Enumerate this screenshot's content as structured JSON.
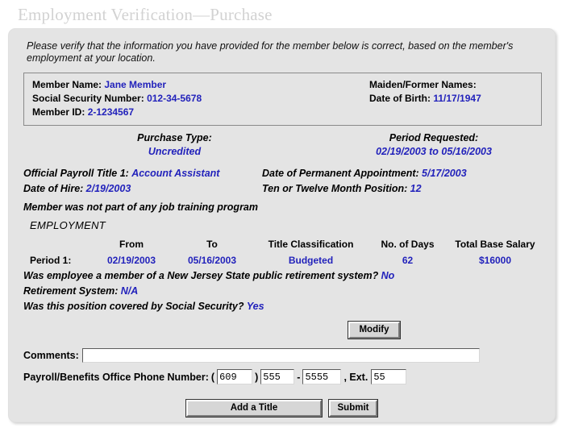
{
  "page": {
    "title": "Employment Verification—Purchase",
    "intro": "Please verify that the information you have provided for the member below is correct, based on the member's employment at your location."
  },
  "member_box": {
    "member_name_label": "Member Name:",
    "member_name_value": "Jane Member",
    "maiden_label": "Maiden/Former Names:",
    "maiden_value": "",
    "ssn_label": "Social Security Number:",
    "ssn_value": "012-34-5678",
    "dob_label": "Date of Birth:",
    "dob_value": "11/17/1947",
    "member_id_label": "Member ID:",
    "member_id_value": "2-1234567"
  },
  "purchase": {
    "purchase_type_label": "Purchase Type:",
    "purchase_type_value": "Uncredited",
    "period_requested_label": "Period Requested:",
    "period_requested_value": "02/19/2003 to 05/16/2003"
  },
  "details": {
    "payroll_title_label": "Official Payroll Title 1:",
    "payroll_title_value": "Account Assistant",
    "permanent_appt_label": "Date of Permanent Appointment:",
    "permanent_appt_value": "5/17/2003",
    "hire_date_label": "Date of Hire:",
    "hire_date_value": "2/19/2003",
    "month_position_label": "Ten or Twelve Month Position:",
    "month_position_value": "12",
    "job_training_note": "Member was not part of any job training program",
    "employment_heading": "EMPLOYMENT"
  },
  "employment_table": {
    "headers": [
      "",
      "From",
      "To",
      "Title Classification",
      "No. of Days",
      "Total Base Salary"
    ],
    "rows": [
      {
        "period": "Period 1:",
        "from": "02/19/2003",
        "to": "05/16/2003",
        "classification": "Budgeted",
        "days": "62",
        "salary": "$16000"
      }
    ]
  },
  "questions": {
    "q1_label": "Was employee a member of a New Jersey State public retirement system?",
    "q1_value": "No",
    "q2_label": "Retirement System:",
    "q2_value": "N/A",
    "q3_label": "Was this position covered by Social Security?",
    "q3_value": "Yes"
  },
  "buttons": {
    "modify": "Modify",
    "add_a_title": "Add a Title",
    "submit": "Submit"
  },
  "form": {
    "comments_label": "Comments:",
    "comments_value": "",
    "comments_placeholder": "",
    "phone_label": "Payroll/Benefits Office Phone Number:",
    "open_paren": "(",
    "close_paren": ")",
    "dash": "-",
    "ext_label": ", Ext.",
    "phone_area": "609",
    "phone_prefix": "555",
    "phone_line": "5555",
    "phone_ext": "55"
  },
  "colors": {
    "value_blue": "#2222bb",
    "panel_bg": "#e4e4e4",
    "title_gray": "#d2d2d2"
  }
}
